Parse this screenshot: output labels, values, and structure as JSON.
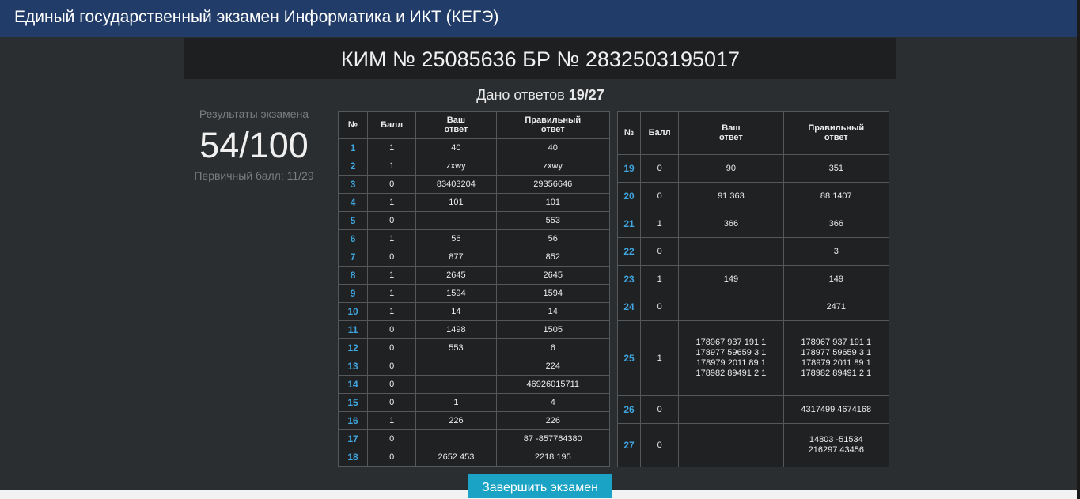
{
  "header": {
    "title": "Единый государственный экзамен Информатика и ИКТ (КЕГЭ)"
  },
  "kim": {
    "text": "КИМ № 25085636 БР № 2832503195017"
  },
  "answers_given": {
    "label": "Дано ответов",
    "value": "19/27"
  },
  "results": {
    "label": "Результаты экзамена",
    "score": "54/100",
    "primary": "Первичный балл: 11/29"
  },
  "table": {
    "col_num": "№",
    "col_score": "Балл",
    "col_yours_1": "Ваш",
    "col_yours_2": "ответ",
    "col_correct_1": "Правильный",
    "col_correct_2": "ответ"
  },
  "rows_left": [
    {
      "n": "1",
      "s": "1",
      "y": "40",
      "c": "40"
    },
    {
      "n": "2",
      "s": "1",
      "y": "zxwy",
      "c": "zxwy"
    },
    {
      "n": "3",
      "s": "0",
      "y": "83403204",
      "c": "29356646"
    },
    {
      "n": "4",
      "s": "1",
      "y": "101",
      "c": "101"
    },
    {
      "n": "5",
      "s": "0",
      "y": "",
      "c": "553"
    },
    {
      "n": "6",
      "s": "1",
      "y": "56",
      "c": "56"
    },
    {
      "n": "7",
      "s": "0",
      "y": "877",
      "c": "852"
    },
    {
      "n": "8",
      "s": "1",
      "y": "2645",
      "c": "2645"
    },
    {
      "n": "9",
      "s": "1",
      "y": "1594",
      "c": "1594"
    },
    {
      "n": "10",
      "s": "1",
      "y": "14",
      "c": "14"
    },
    {
      "n": "11",
      "s": "0",
      "y": "1498",
      "c": "1505"
    },
    {
      "n": "12",
      "s": "0",
      "y": "553",
      "c": "6"
    },
    {
      "n": "13",
      "s": "0",
      "y": "",
      "c": "224"
    },
    {
      "n": "14",
      "s": "0",
      "y": "",
      "c": "46926015711"
    },
    {
      "n": "15",
      "s": "0",
      "y": "1",
      "c": "4"
    },
    {
      "n": "16",
      "s": "1",
      "y": "226",
      "c": "226"
    },
    {
      "n": "17",
      "s": "0",
      "y": "",
      "c": "87 -857764380"
    },
    {
      "n": "18",
      "s": "0",
      "y": "2652 453",
      "c": "2218 195"
    }
  ],
  "rows_right": [
    {
      "n": "19",
      "s": "0",
      "y": [
        "90"
      ],
      "c": [
        "351"
      ]
    },
    {
      "n": "20",
      "s": "0",
      "y": [
        "91 363"
      ],
      "c": [
        "88 1407"
      ]
    },
    {
      "n": "21",
      "s": "1",
      "y": [
        "366"
      ],
      "c": [
        "366"
      ]
    },
    {
      "n": "22",
      "s": "0",
      "y": [],
      "c": [
        "3"
      ]
    },
    {
      "n": "23",
      "s": "1",
      "y": [
        "149"
      ],
      "c": [
        "149"
      ]
    },
    {
      "n": "24",
      "s": "0",
      "y": [],
      "c": [
        "2471"
      ]
    },
    {
      "n": "25",
      "s": "1",
      "y": [
        "178967 937 191 1",
        "178977 59659 3 1",
        "178979 2011 89 1",
        "178982 89491 2 1"
      ],
      "c": [
        "178967 937 191 1",
        "178977 59659 3 1",
        "178979 2011 89 1",
        "178982 89491 2 1"
      ]
    },
    {
      "n": "26",
      "s": "0",
      "y": [],
      "c": [
        "4317499 4674168"
      ]
    },
    {
      "n": "27",
      "s": "0",
      "y": [],
      "c": [
        "14803 -51534",
        "216297 43456"
      ]
    }
  ],
  "finish_button": {
    "label": "Завершить экзамен"
  },
  "colors": {
    "header_bg": "#213c68",
    "page_bg": "#2b2e30",
    "task_number": "#3fa6e0",
    "button_bg": "#1aa3c4"
  }
}
